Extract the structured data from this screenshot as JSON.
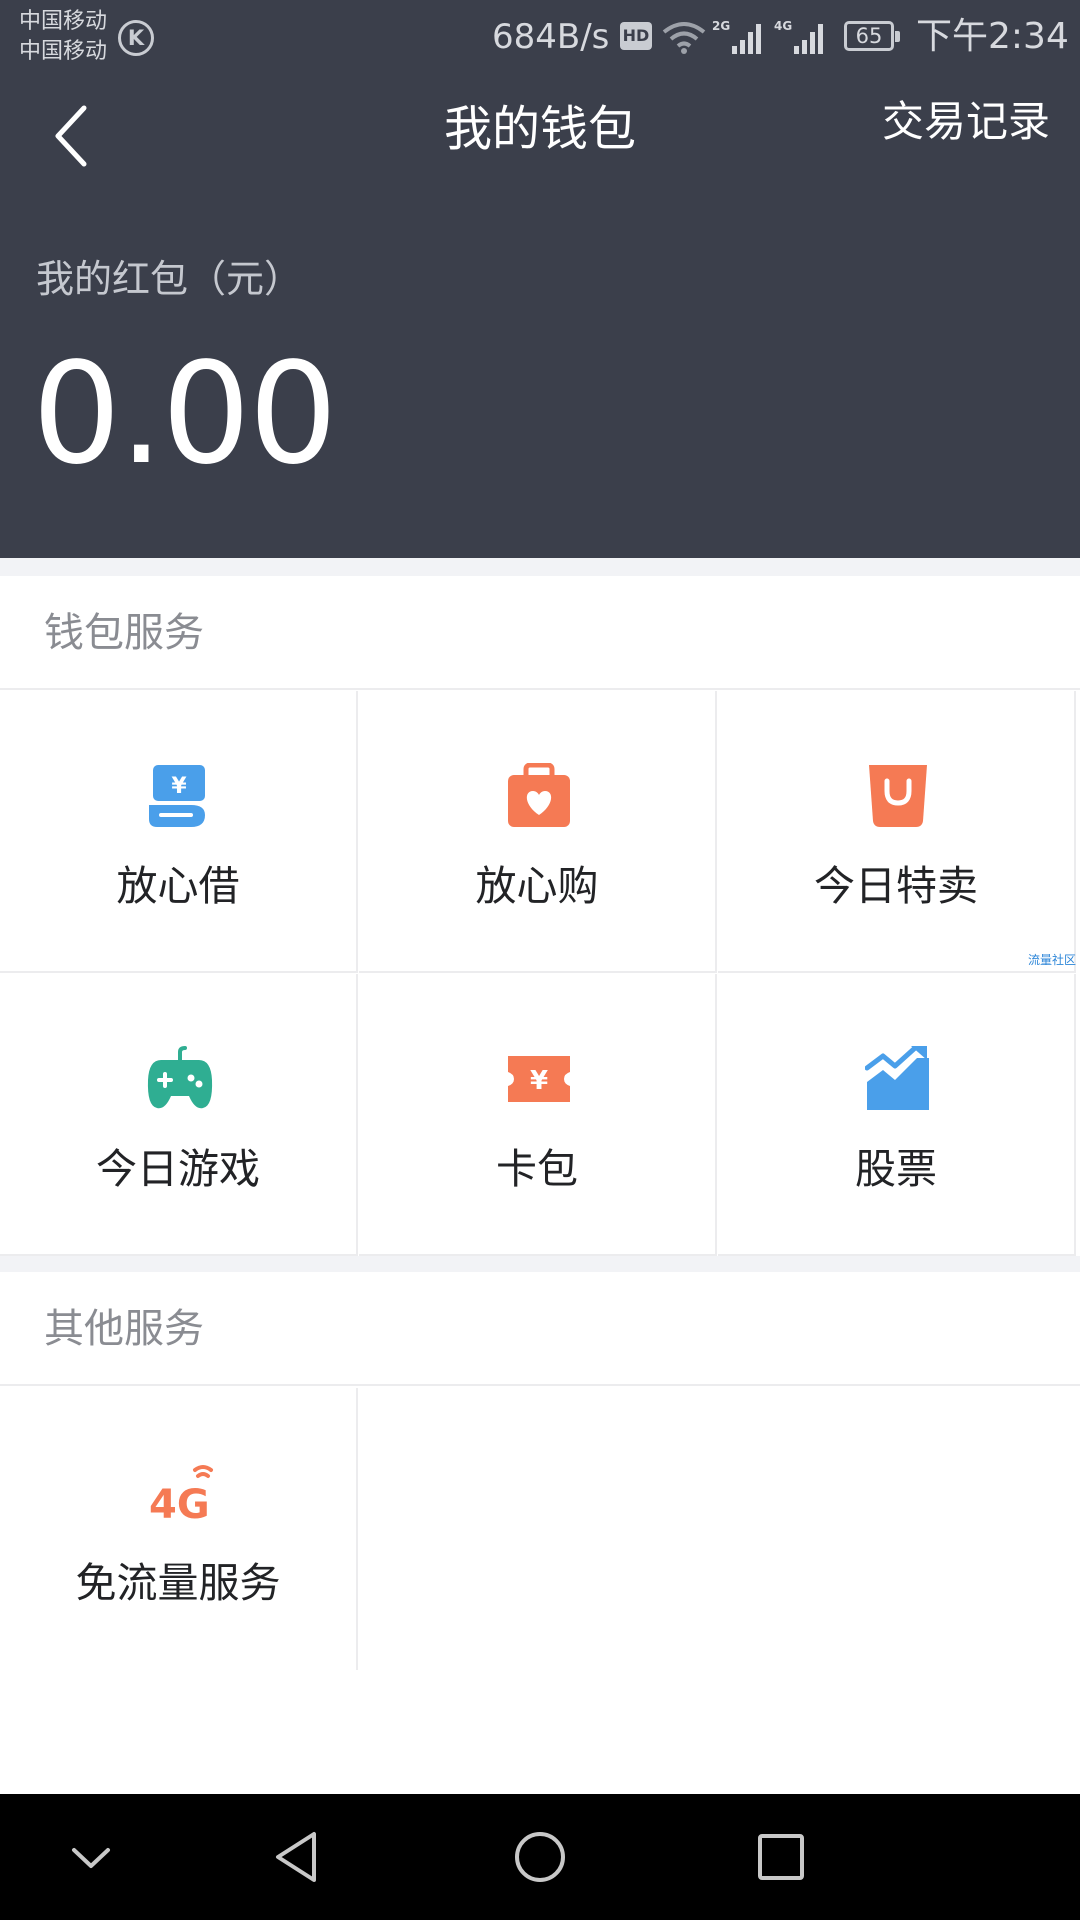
{
  "status": {
    "carrier1": "中国移动",
    "carrier2": "中国移动",
    "k_badge": "K",
    "net_speed": "684B/s",
    "hd": "HD",
    "sig1_label": "2G",
    "sig2_label": "4G",
    "battery": "65",
    "time": "下午2:34"
  },
  "header": {
    "title": "我的钱包",
    "action": "交易记录"
  },
  "redpacket": {
    "label": "我的红包（元）",
    "amount": "0.00"
  },
  "wallet_services": {
    "title": "钱包服务",
    "items": [
      {
        "label": "放心借",
        "icon": "loan-icon"
      },
      {
        "label": "放心购",
        "icon": "shopping-bag-heart-icon"
      },
      {
        "label": "今日特卖",
        "icon": "shopping-bag-icon"
      },
      {
        "label": "今日游戏",
        "icon": "gamepad-icon"
      },
      {
        "label": "卡包",
        "icon": "coupon-icon"
      },
      {
        "label": "股票",
        "icon": "stock-chart-icon"
      }
    ]
  },
  "other_services": {
    "title": "其他服务",
    "items": [
      {
        "label": "免流量服务",
        "icon": "4g-icon",
        "icon_text": "4G"
      }
    ]
  },
  "watermark": "流量社区",
  "colors": {
    "header_bg": "#3b3f4b",
    "blue": "#4a9fea",
    "orange": "#f57a54",
    "green": "#2fae92"
  }
}
